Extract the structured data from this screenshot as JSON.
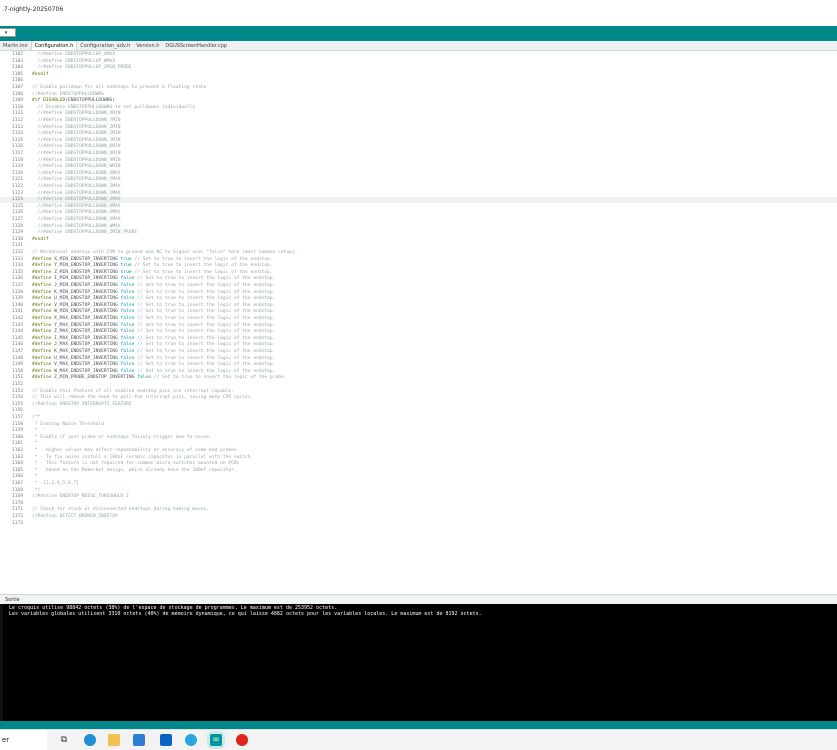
{
  "window": {
    "title": ".7-nightly-20250706"
  },
  "toolbar": {
    "board_label": "▾"
  },
  "tabs": [
    "Marlin.ino",
    "Configuration.h",
    "Configuration_adv.h",
    "Version.h",
    "DGUSScreenHandler.cpp"
  ],
  "active_tab": 1,
  "editor": {
    "current_line": "1124",
    "lines": [
      {
        "n": "1102",
        "t": "  //#define ENDSTOPPULLUP_UMAX"
      },
      {
        "n": "1103",
        "t": "  //#define ENDSTOPPULLUP_WMAX"
      },
      {
        "n": "1104",
        "t": "  //#define ENDSTOPPULLUP_ZMIN_PROBE"
      },
      {
        "n": "1105",
        "t": "#endif"
      },
      {
        "n": "1106",
        "t": ""
      },
      {
        "n": "1107",
        "t": "// Enable pulldown for all endstops to prevent a floating state"
      },
      {
        "n": "1108",
        "t": "//#define ENDSTOPPULLDOWNS"
      },
      {
        "n": "1109",
        "t": "#if DISABLED(ENDSTOPPULLDOWNS)"
      },
      {
        "n": "1110",
        "t": "  // Disable ENDSTOPPULLDOWNS to set pulldowns individually"
      },
      {
        "n": "1111",
        "t": "  //#define ENDSTOPPULLDOWN_XMIN"
      },
      {
        "n": "1112",
        "t": "  //#define ENDSTOPPULLDOWN_YMIN"
      },
      {
        "n": "1113",
        "t": "  //#define ENDSTOPPULLDOWN_ZMIN"
      },
      {
        "n": "1114",
        "t": "  //#define ENDSTOPPULLDOWN_IMIN"
      },
      {
        "n": "1115",
        "t": "  //#define ENDSTOPPULLDOWN_JMIN"
      },
      {
        "n": "1116",
        "t": "  //#define ENDSTOPPULLDOWN_KMIN"
      },
      {
        "n": "1117",
        "t": "  //#define ENDSTOPPULLDOWN_UMIN"
      },
      {
        "n": "1118",
        "t": "  //#define ENDSTOPPULLDOWN_VMIN"
      },
      {
        "n": "1119",
        "t": "  //#define ENDSTOPPULLDOWN_WMIN"
      },
      {
        "n": "1120",
        "t": "  //#define ENDSTOPPULLDOWN_XMAX"
      },
      {
        "n": "1121",
        "t": "  //#define ENDSTOPPULLDOWN_YMAX"
      },
      {
        "n": "1122",
        "t": "  //#define ENDSTOPPULLDOWN_ZMAX"
      },
      {
        "n": "1123",
        "t": "  //#define ENDSTOPPULLDOWN_IMAX"
      },
      {
        "n": "1124",
        "t": "  //#define ENDSTOPPULLDOWN_JMAX"
      },
      {
        "n": "1125",
        "t": "  //#define ENDSTOPPULLDOWN_KMAX"
      },
      {
        "n": "1126",
        "t": "  //#define ENDSTOPPULLDOWN_UMAX"
      },
      {
        "n": "1127",
        "t": "  //#define ENDSTOPPULLDOWN_VMAX"
      },
      {
        "n": "1128",
        "t": "  //#define ENDSTOPPULLDOWN_WMAX"
      },
      {
        "n": "1129",
        "t": "  //#define ENDSTOPPULLDOWN_ZMIN_PROBE"
      },
      {
        "n": "1130",
        "t": "#endif"
      },
      {
        "n": "1131",
        "t": ""
      },
      {
        "n": "1132",
        "t": "// Mechanical endstop with COM to ground and NC to Signal uses \"false\" here (most common setup)."
      },
      {
        "n": "1133",
        "t": "#define X_MIN_ENDSTOP_INVERTING true // Set to true to invert the logic of the endstop."
      },
      {
        "n": "1134",
        "t": "#define Y_MIN_ENDSTOP_INVERTING true // Set to true to invert the logic of the endstop."
      },
      {
        "n": "1135",
        "t": "#define Z_MIN_ENDSTOP_INVERTING true // Set to true to invert the logic of the endstop."
      },
      {
        "n": "1136",
        "t": "#define I_MIN_ENDSTOP_INVERTING false // Set to true to invert the logic of the endstop."
      },
      {
        "n": "1137",
        "t": "#define J_MIN_ENDSTOP_INVERTING false // Set to true to invert the logic of the endstop."
      },
      {
        "n": "1138",
        "t": "#define K_MIN_ENDSTOP_INVERTING false // Set to true to invert the logic of the endstop."
      },
      {
        "n": "1139",
        "t": "#define U_MIN_ENDSTOP_INVERTING false // Set to true to invert the logic of the endstop."
      },
      {
        "n": "1140",
        "t": "#define V_MIN_ENDSTOP_INVERTING false // Set to true to invert the logic of the endstop."
      },
      {
        "n": "1141",
        "t": "#define W_MIN_ENDSTOP_INVERTING false // Set to true to invert the logic of the endstop."
      },
      {
        "n": "1142",
        "t": "#define X_MAX_ENDSTOP_INVERTING false // Set to true to invert the logic of the endstop."
      },
      {
        "n": "1143",
        "t": "#define Y_MAX_ENDSTOP_INVERTING false // Set to true to invert the logic of the endstop."
      },
      {
        "n": "1144",
        "t": "#define Z_MAX_ENDSTOP_INVERTING false // Set to true to invert the logic of the endstop."
      },
      {
        "n": "1145",
        "t": "#define I_MAX_ENDSTOP_INVERTING false // Set to true to invert the logic of the endstop."
      },
      {
        "n": "1146",
        "t": "#define J_MAX_ENDSTOP_INVERTING false // Set to true to invert the logic of the endstop."
      },
      {
        "n": "1147",
        "t": "#define K_MAX_ENDSTOP_INVERTING false // Set to true to invert the logic of the endstop."
      },
      {
        "n": "1148",
        "t": "#define U_MAX_ENDSTOP_INVERTING false // Set to true to invert the logic of the endstop."
      },
      {
        "n": "1149",
        "t": "#define V_MAX_ENDSTOP_INVERTING false // Set to true to invert the logic of the endstop."
      },
      {
        "n": "1150",
        "t": "#define W_MAX_ENDSTOP_INVERTING false // Set to true to invert the logic of the endstop."
      },
      {
        "n": "1151",
        "t": "#define Z_MIN_PROBE_ENDSTOP_INVERTING false // Set to true to invert the logic of the probe."
      },
      {
        "n": "1152",
        "t": ""
      },
      {
        "n": "1153",
        "t": "// Enable this feature if all enabled endstop pins are interrupt-capable."
      },
      {
        "n": "1154",
        "t": "// This will remove the need to poll the interrupt pins, saving many CPU cycles."
      },
      {
        "n": "1155",
        "t": "//#define ENDSTOP_INTERRUPTS_FEATURE"
      },
      {
        "n": "1156",
        "t": ""
      },
      {
        "n": "1157",
        "t": "/**"
      },
      {
        "n": "1158",
        "t": " * Endstop Noise Threshold"
      },
      {
        "n": "1159",
        "t": " *"
      },
      {
        "n": "1160",
        "t": " * Enable if your probe or endstops falsely trigger due to noise."
      },
      {
        "n": "1161",
        "t": " *"
      },
      {
        "n": "1162",
        "t": " * - Higher values may affect repeatability or accuracy of some bed probes."
      },
      {
        "n": "1163",
        "t": " * - To fix noise install a 100nF ceramic capacitor in parallel with the switch."
      },
      {
        "n": "1164",
        "t": " * - This feature is not required for common micro-switches mounted on PCBs"
      },
      {
        "n": "1165",
        "t": " *   based on the Makerbot design, which already have the 100nF capacitor."
      },
      {
        "n": "1166",
        "t": " *"
      },
      {
        "n": "1167",
        "t": " * :[2,3,4,5,6,7]"
      },
      {
        "n": "1168",
        "t": " */"
      },
      {
        "n": "1169",
        "t": "//#define ENDSTOP_NOISE_THRESHOLD 2"
      },
      {
        "n": "1170",
        "t": ""
      },
      {
        "n": "1171",
        "t": "// Check for stuck or disconnected endstops during homing moves."
      },
      {
        "n": "1172",
        "t": "//#define DETECT_BROKEN_ENDSTOP"
      },
      {
        "n": "1173",
        "t": ""
      }
    ]
  },
  "output": {
    "title": "Sortie",
    "lines": [
      "Le croquis utilise 98842 octets (38%) de l'espace de stockage de programmes. Le maximum est de 253952 octets.",
      "Les variables globales utilisent 3310 octets (40%) de mémoire dynamique, ce qui laisse 4882 octets pour les variables locales. Le maximum est de 8192 octets."
    ]
  },
  "taskbar": {
    "search_text": "er",
    "icons": [
      "task-view-icon",
      "edge-icon",
      "file-explorer-icon",
      "store-icon",
      "outlook-icon",
      "edge-icon-2",
      "arduino-icon",
      "acrobat-icon"
    ]
  },
  "colors": {
    "teal": "#00878a",
    "comment": "#95a5a6",
    "preprocessor": "#5e6d03",
    "keyword": "#00979c"
  }
}
